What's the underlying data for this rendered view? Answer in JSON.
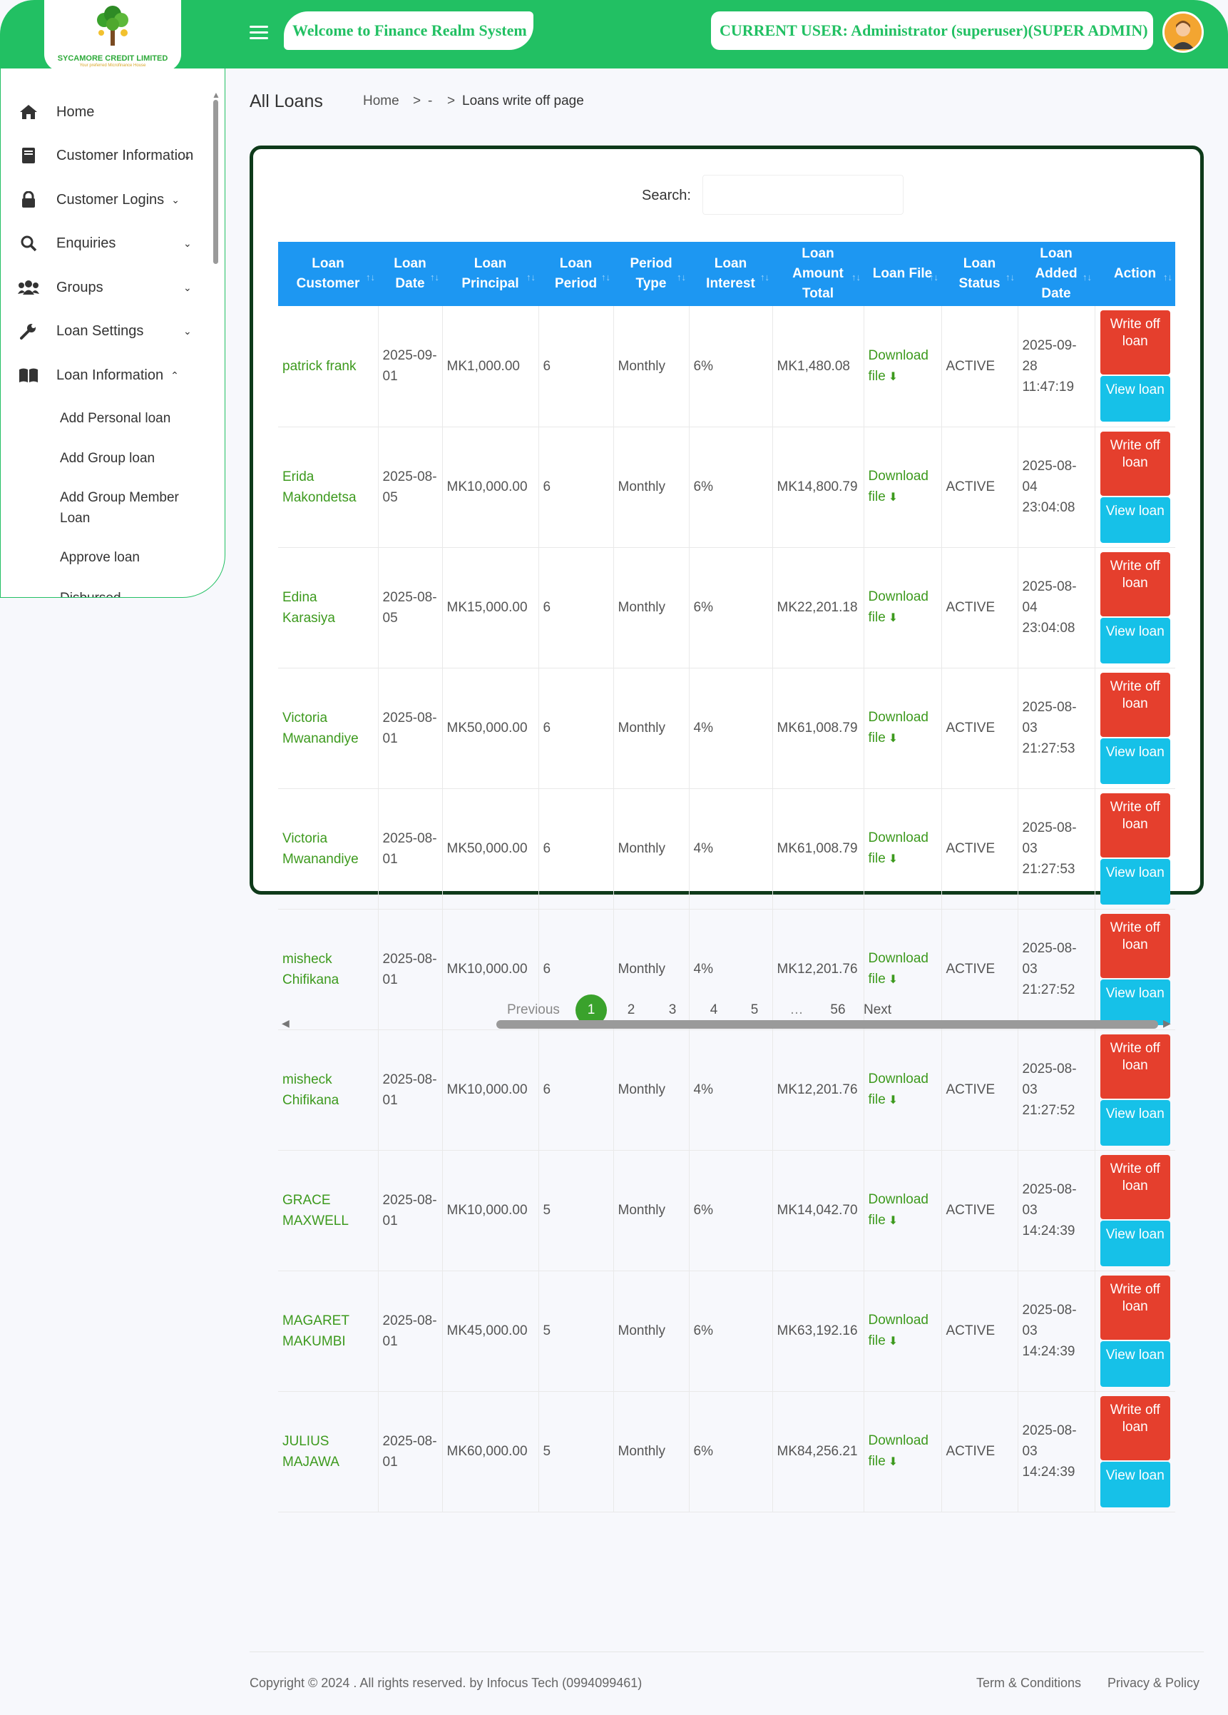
{
  "header": {
    "logo_name": "SYCAMORE CREDIT LIMITED",
    "logo_tagline": "Your preferred Microfinance House",
    "welcome": "Welcome to Finance Realm System",
    "current_user": "CURRENT USER: Administrator (superuser)(SUPER ADMIN)"
  },
  "sidebar": {
    "items": [
      {
        "label": "Home",
        "icon": "home-icon",
        "chevron": ""
      },
      {
        "label": "Customer Information",
        "icon": "book-icon",
        "chevron": "⌄"
      },
      {
        "label": "Customer Logins",
        "icon": "lock-icon",
        "chevron": "⌄"
      },
      {
        "label": "Enquiries",
        "icon": "search-icon",
        "chevron": "⌄"
      },
      {
        "label": "Groups",
        "icon": "users-icon",
        "chevron": "⌄"
      },
      {
        "label": "Loan Settings",
        "icon": "wrench-icon",
        "chevron": "⌄"
      },
      {
        "label": "Loan Information",
        "icon": "open-book-icon",
        "chevron": "⌃"
      }
    ],
    "sub_items": [
      "Add Personal loan",
      "Add Group loan",
      "Add Group Member Loan",
      "Approve loan",
      "Disbursed"
    ]
  },
  "page": {
    "title": "All Loans",
    "breadcrumb": [
      "Home",
      "-",
      "Loans write off page"
    ],
    "breadcrumb_sep": ">"
  },
  "search": {
    "label": "Search:",
    "value": ""
  },
  "table": {
    "headers": [
      "Loan Customer",
      "Loan Date",
      "Loan Principal",
      "Loan Period",
      "Period Type",
      "Loan Interest",
      "Loan Amount Total",
      "Loan File",
      "Loan Status",
      "Loan Added Date",
      "Action"
    ],
    "download_label": "Download file",
    "write_off_label": "Write off loan",
    "view_label": "View loan",
    "rows": [
      {
        "customer": "patrick frank",
        "date": "2025-09-01",
        "principal": "MK1,000.00",
        "period": "6",
        "type": "Monthly",
        "interest": "6%",
        "total": "MK1,480.08",
        "status": "ACTIVE",
        "added": "2025-09-28 11:47:19"
      },
      {
        "customer": "Erida Makondetsa",
        "date": "2025-08-05",
        "principal": "MK10,000.00",
        "period": "6",
        "type": "Monthly",
        "interest": "6%",
        "total": "MK14,800.79",
        "status": "ACTIVE",
        "added": "2025-08-04 23:04:08"
      },
      {
        "customer": "Edina Karasiya",
        "date": "2025-08-05",
        "principal": "MK15,000.00",
        "period": "6",
        "type": "Monthly",
        "interest": "6%",
        "total": "MK22,201.18",
        "status": "ACTIVE",
        "added": "2025-08-04 23:04:08"
      },
      {
        "customer": "Victoria Mwanandiye",
        "date": "2025-08-01",
        "principal": "MK50,000.00",
        "period": "6",
        "type": "Monthly",
        "interest": "4%",
        "total": "MK61,008.79",
        "status": "ACTIVE",
        "added": "2025-08-03 21:27:53"
      },
      {
        "customer": "Victoria Mwanandiye",
        "date": "2025-08-01",
        "principal": "MK50,000.00",
        "period": "6",
        "type": "Monthly",
        "interest": "4%",
        "total": "MK61,008.79",
        "status": "ACTIVE",
        "added": "2025-08-03 21:27:53"
      },
      {
        "customer": "misheck Chifikana",
        "date": "2025-08-01",
        "principal": "MK10,000.00",
        "period": "6",
        "type": "Monthly",
        "interest": "4%",
        "total": "MK12,201.76",
        "status": "ACTIVE",
        "added": "2025-08-03 21:27:52"
      },
      {
        "customer": "misheck Chifikana",
        "date": "2025-08-01",
        "principal": "MK10,000.00",
        "period": "6",
        "type": "Monthly",
        "interest": "4%",
        "total": "MK12,201.76",
        "status": "ACTIVE",
        "added": "2025-08-03 21:27:52"
      },
      {
        "customer": "GRACE MAXWELL",
        "date": "2025-08-01",
        "principal": "MK10,000.00",
        "period": "5",
        "type": "Monthly",
        "interest": "6%",
        "total": "MK14,042.70",
        "status": "ACTIVE",
        "added": "2025-08-03 14:24:39"
      },
      {
        "customer": "MAGARET MAKUMBI",
        "date": "2025-08-01",
        "principal": "MK45,000.00",
        "period": "5",
        "type": "Monthly",
        "interest": "6%",
        "total": "MK63,192.16",
        "status": "ACTIVE",
        "added": "2025-08-03 14:24:39"
      },
      {
        "customer": "JULIUS MAJAWA",
        "date": "2025-08-01",
        "principal": "MK60,000.00",
        "period": "5",
        "type": "Monthly",
        "interest": "6%",
        "total": "MK84,256.21",
        "status": "ACTIVE",
        "added": "2025-08-03 14:24:39"
      }
    ]
  },
  "pagination": {
    "previous": "Previous",
    "pages": [
      "1",
      "2",
      "3",
      "4",
      "5",
      "…",
      "56"
    ],
    "current": "1",
    "next": "Next"
  },
  "footer": {
    "copyright": "Copyright © 2024 . All rights reserved. by Infocus Tech (0994099461)",
    "terms": "Term & Conditions",
    "privacy": "Privacy & Policy"
  },
  "colors": {
    "brand_green": "#22c063",
    "table_header_blue": "#1d97f2",
    "write_off_red": "#e53f2d",
    "view_cyan": "#16c1e8",
    "link_green": "#3d9a1e"
  }
}
